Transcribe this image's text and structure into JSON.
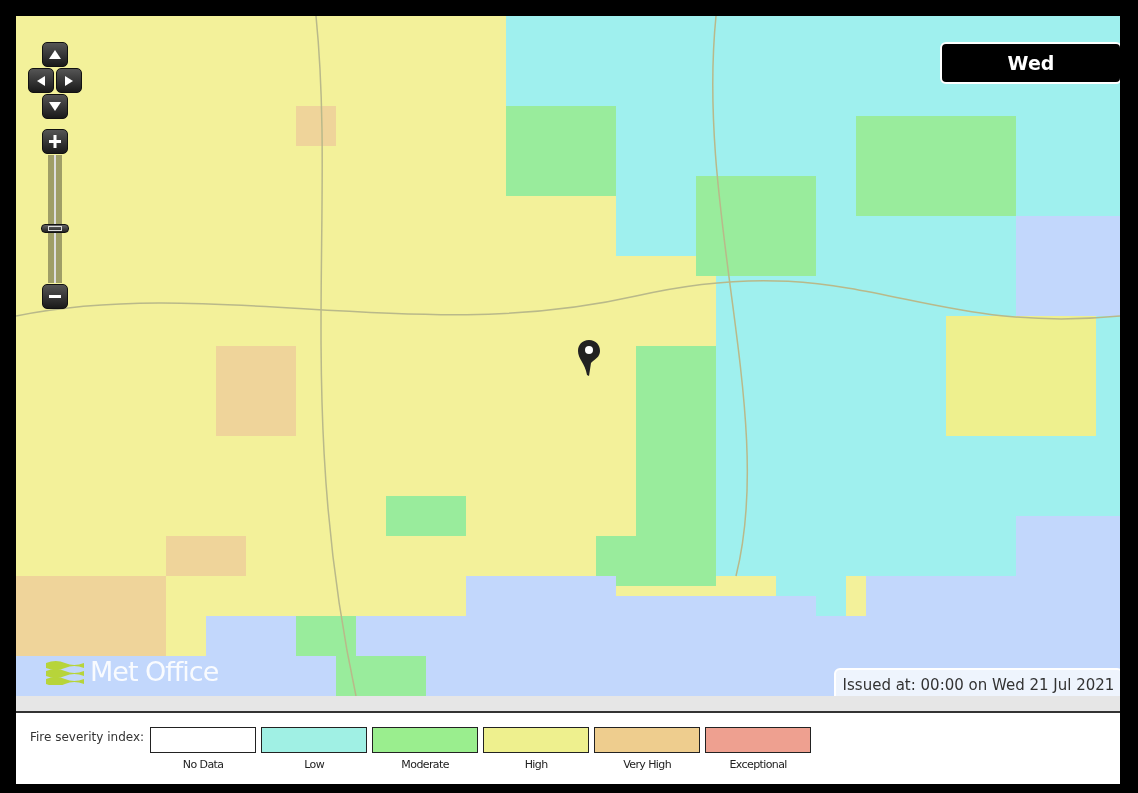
{
  "map": {
    "kind": "picture",
    "day": "Wed",
    "logo": "Met Office",
    "issued": "Issued at: 00:00 on Wed 21 Jul 2021"
  },
  "legend": {
    "title": "Fire severity index:",
    "items": [
      {
        "label": "No Data",
        "color": "#ffffff"
      },
      {
        "label": "Low",
        "color": "#a0f0e4"
      },
      {
        "label": "Moderate",
        "color": "#9aee8e"
      },
      {
        "label": "High",
        "color": "#eef08e"
      },
      {
        "label": "Very High",
        "color": "#eecd8e"
      },
      {
        "label": "Exceptional",
        "color": "#eea090"
      }
    ]
  }
}
